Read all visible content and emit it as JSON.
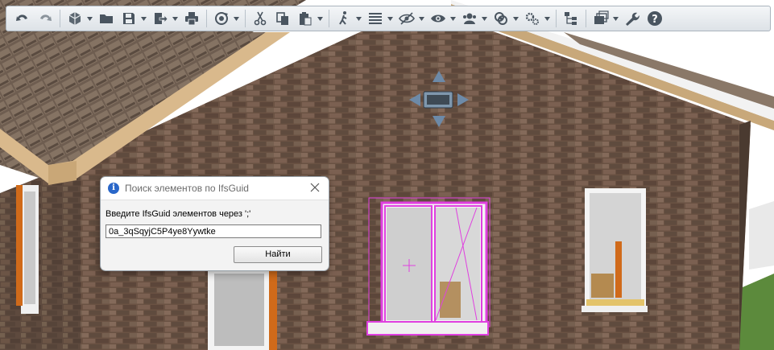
{
  "toolbar": {
    "buttons": [
      {
        "icon": "undo-icon"
      },
      {
        "icon": "redo-icon"
      },
      {
        "icon": "cube-view-icon",
        "dropdown": true
      },
      {
        "icon": "open-folder-icon"
      },
      {
        "icon": "save-icon",
        "dropdown": true
      },
      {
        "icon": "export-icon",
        "dropdown": true
      },
      {
        "icon": "print-icon"
      },
      {
        "icon": "orbit-icon",
        "dropdown": true
      },
      {
        "icon": "cut-icon"
      },
      {
        "icon": "copy-icon"
      },
      {
        "icon": "paste-icon",
        "dropdown": true
      },
      {
        "icon": "walk-icon",
        "dropdown": true
      },
      {
        "icon": "list-icon",
        "dropdown": true
      },
      {
        "icon": "hide-icon",
        "dropdown": true
      },
      {
        "icon": "show-icon",
        "dropdown": true
      },
      {
        "icon": "users-icon",
        "dropdown": true
      },
      {
        "icon": "clash-icon",
        "dropdown": true
      },
      {
        "icon": "settings-icon",
        "dropdown": true
      },
      {
        "icon": "model-tree-icon"
      },
      {
        "icon": "layers-icon",
        "dropdown": true
      },
      {
        "icon": "wrench-icon"
      },
      {
        "icon": "help-icon"
      }
    ]
  },
  "dialog": {
    "title": "Поиск элементов по IfsGuid",
    "label": "Введите IfsGuid элементов через ';'",
    "input_value": "0a_3qSqyjC5P4ye8Yywtke",
    "find_button": "Найти"
  },
  "colors": {
    "highlight": "#e040e0",
    "toolbar_icon": "#4a5560",
    "brick": "#6d5446",
    "roof": "#7a6a5c",
    "fascia": "#d9b98c"
  }
}
